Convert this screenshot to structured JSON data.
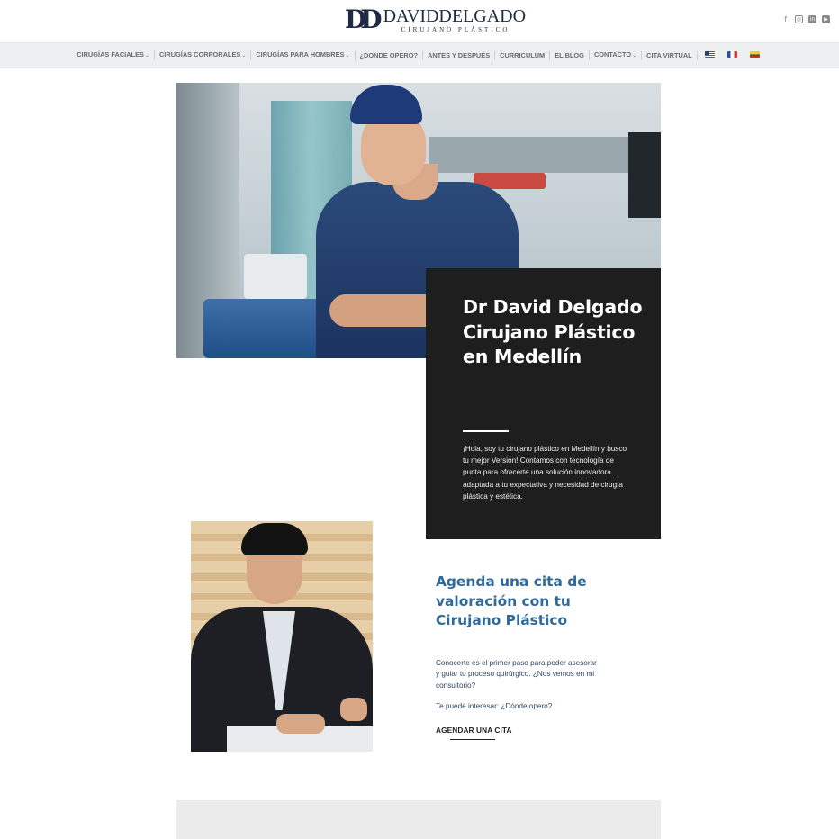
{
  "header": {
    "logo_mark": "DD",
    "logo_name": "DAVIDDELGADO",
    "logo_sub": "CIRUJANO PLÁSTICO",
    "social": [
      "facebook-icon",
      "instagram-icon",
      "linkedin-icon",
      "youtube-icon"
    ]
  },
  "nav": {
    "items": [
      {
        "label": "CIRUGÍAS FACIALES",
        "dropdown": true
      },
      {
        "label": "CIRUGÍAS CORPORALES",
        "dropdown": true
      },
      {
        "label": "CIRUGÍAS PARA HOMBRES",
        "dropdown": true
      },
      {
        "label": "¿DONDE OPERO?",
        "dropdown": false
      },
      {
        "label": "ANTES Y DESPUÉS",
        "dropdown": false
      },
      {
        "label": "CURRICULUM",
        "dropdown": false
      },
      {
        "label": "EL BLOG",
        "dropdown": false
      },
      {
        "label": "CONTACTO",
        "dropdown": true
      },
      {
        "label": "CITA VIRTUAL",
        "dropdown": false
      }
    ],
    "chevron": "⌄",
    "flags": [
      "us-flag",
      "fr-flag",
      "co-flag"
    ]
  },
  "hero": {
    "title": "Dr David Delgado Cirujano Plástico en Medellín",
    "text": "¡Hola, soy tu cirujano plástico en Medellín y busco tu mejor Versión! Contamos con tecnología de punta para ofrecerte una solución innovadora adaptada a tu expectativa y necesidad de cirugía plástica y estética."
  },
  "appointment": {
    "title": "Agenda una cita de valoración con tu Cirujano Plástico",
    "text": "Conocerte es el primer paso para poder asesorar y guiar tu proceso quirúrgico. ¿Nos vemos en mi consultorio?",
    "interest_prefix": "Te puede interesar: ",
    "interest_link": "¿Dónde opero?",
    "button": "AGENDAR UNA CITA"
  },
  "colors": {
    "accent_blue": "#2e6a9e",
    "card_dark": "#1e1e1e",
    "nav_bg": "#eeeff0"
  }
}
